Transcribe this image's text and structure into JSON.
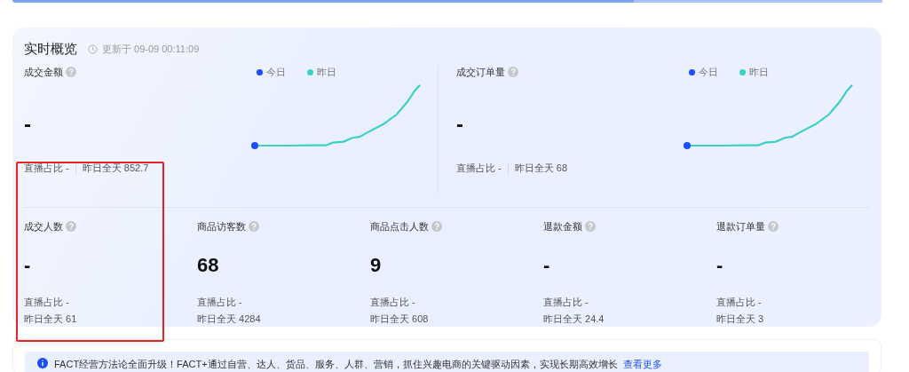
{
  "overview": {
    "title": "实时概览",
    "updated": "更新于 09-09 00:11:09",
    "trend_metrics": [
      {
        "label": "成交金额",
        "value": "-",
        "live_share": "直播占比 -",
        "yesterday": "昨日全天 852.7",
        "legend": [
          {
            "label": "今日",
            "color": "#1a4dff"
          },
          {
            "label": "昨日",
            "color": "#3ad1c8"
          }
        ]
      },
      {
        "label": "成交订单量",
        "value": "-",
        "live_share": "直播占比 -",
        "yesterday": "昨日全天 68",
        "legend": [
          {
            "label": "今日",
            "color": "#1a4dff"
          },
          {
            "label": "昨日",
            "color": "#3ad1c8"
          }
        ]
      }
    ],
    "metrics": [
      {
        "label": "成交人数",
        "value": "-",
        "live_share": "直播占比 -",
        "yesterday": "昨日全天 61",
        "highlighted": true
      },
      {
        "label": "商品访客数",
        "value": "68",
        "live_share": "直播占比 -",
        "yesterday": "昨日全天 4284",
        "highlighted": false
      },
      {
        "label": "商品点击人数",
        "value": "9",
        "live_share": "直播占比 -",
        "yesterday": "昨日全天 608",
        "highlighted": false
      },
      {
        "label": "退款金额",
        "value": "-",
        "live_share": "直播占比 -",
        "yesterday": "昨日全天 24.4",
        "highlighted": false
      },
      {
        "label": "退款订单量",
        "value": "-",
        "live_share": "直播占比 -",
        "yesterday": "昨日全天 3",
        "highlighted": false
      }
    ]
  },
  "notice": {
    "text": "FACT经营方法论全面升级！FACT+通过自营、达人、货品、服务、人群、营销，抓住兴趣电商的关键驱动因素，实现长期高效增长",
    "link": "查看更多"
  }
}
